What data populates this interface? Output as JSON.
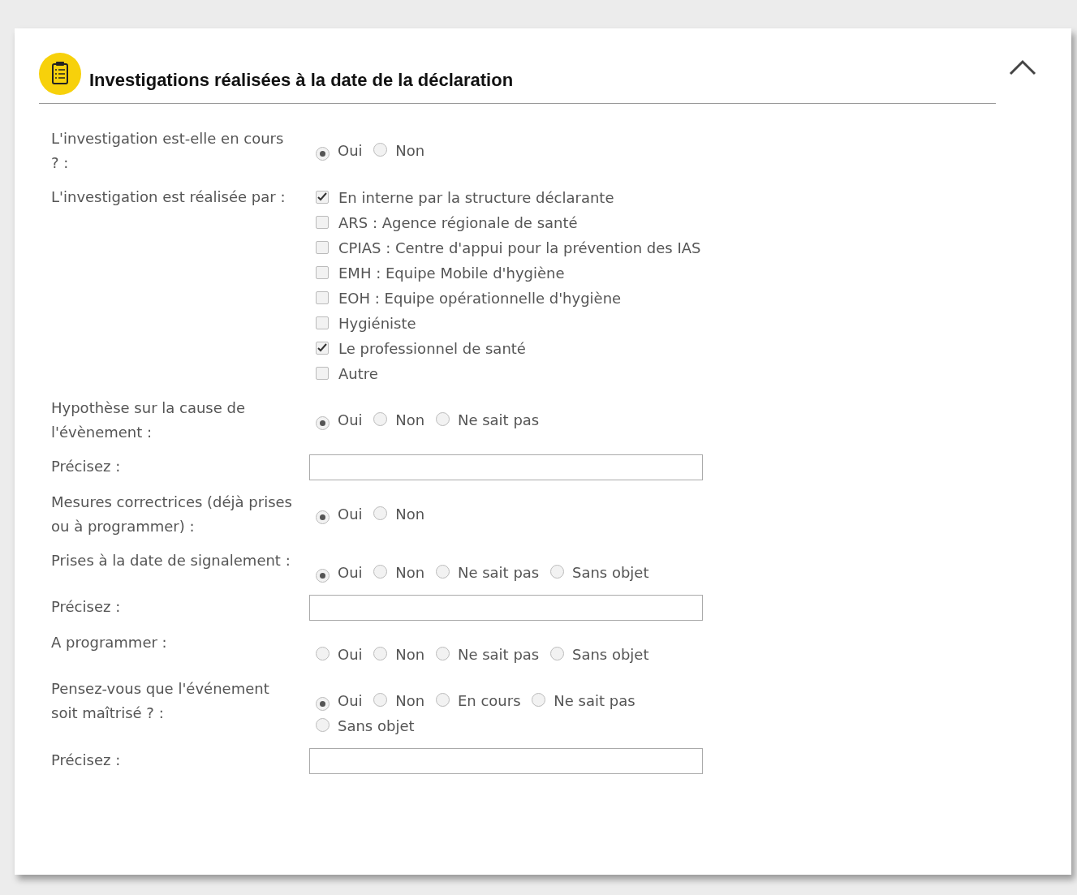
{
  "section": {
    "title": "Investigations réalisées à la date de la déclaration",
    "expanded": true
  },
  "rows": [
    {
      "kind": "radio",
      "label": "L'investigation est-elle en cours ? :",
      "options": [
        {
          "label": "Oui",
          "selected": true
        },
        {
          "label": "Non",
          "selected": false
        }
      ]
    },
    {
      "kind": "checkbox",
      "label": "L'investigation est réalisée par :",
      "options": [
        {
          "label": "En interne par la structure déclarante",
          "checked": true
        },
        {
          "label": "ARS : Agence régionale de santé",
          "checked": false
        },
        {
          "label": "CPIAS : Centre d'appui pour la prévention des IAS",
          "checked": false
        },
        {
          "label": "EMH : Equipe Mobile d'hygiène",
          "checked": false
        },
        {
          "label": "EOH : Equipe opérationnelle d'hygiène",
          "checked": false
        },
        {
          "label": "Hygiéniste",
          "checked": false
        },
        {
          "label": "Le professionnel de santé",
          "checked": true
        },
        {
          "label": "Autre",
          "checked": false
        }
      ]
    },
    {
      "kind": "radio",
      "label": "Hypothèse sur la cause de l'évènement :",
      "options": [
        {
          "label": "Oui",
          "selected": true
        },
        {
          "label": "Non",
          "selected": false
        },
        {
          "label": "Ne sait pas",
          "selected": false
        }
      ]
    },
    {
      "kind": "text",
      "label": "Précisez :"
    },
    {
      "kind": "radio",
      "label": "Mesures correctrices (déjà prises ou à programmer) :",
      "options": [
        {
          "label": "Oui",
          "selected": true
        },
        {
          "label": "Non",
          "selected": false
        }
      ]
    },
    {
      "kind": "radio",
      "label": "Prises à la date de signalement :",
      "options": [
        {
          "label": "Oui",
          "selected": true
        },
        {
          "label": "Non",
          "selected": false
        },
        {
          "label": "Ne sait pas",
          "selected": false
        },
        {
          "label": "Sans objet",
          "selected": false
        }
      ]
    },
    {
      "kind": "text",
      "label": "Précisez :"
    },
    {
      "kind": "radio",
      "label": "A programmer :",
      "options": [
        {
          "label": "Oui",
          "selected": false
        },
        {
          "label": "Non",
          "selected": false
        },
        {
          "label": "Ne sait pas",
          "selected": false
        },
        {
          "label": "Sans objet",
          "selected": false
        }
      ]
    },
    {
      "kind": "radio",
      "label": "Pensez-vous que l'événement soit maîtrisé ? :",
      "options": [
        {
          "label": "Oui",
          "selected": true
        },
        {
          "label": "Non",
          "selected": false
        },
        {
          "label": "En cours",
          "selected": false
        },
        {
          "label": "Ne sait pas",
          "selected": false
        },
        {
          "label": "Sans objet",
          "selected": false
        }
      ]
    },
    {
      "kind": "text",
      "label": "Précisez :"
    }
  ]
}
